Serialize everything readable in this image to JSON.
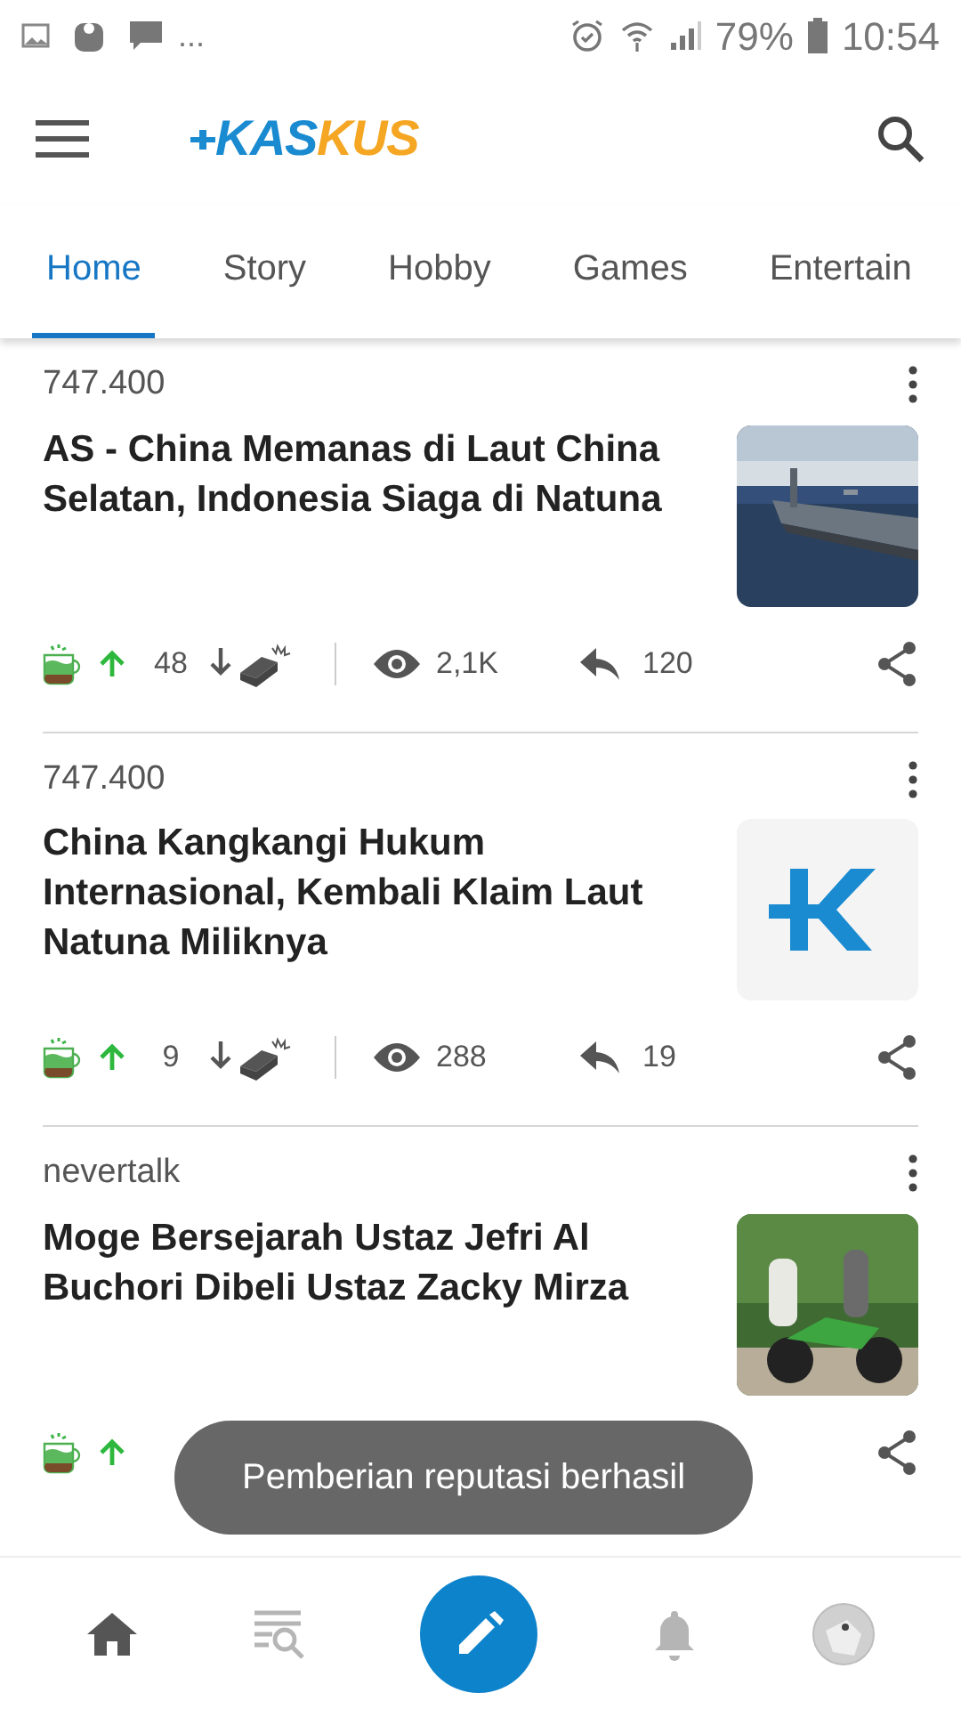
{
  "status_bar": {
    "more": "...",
    "battery": "79%",
    "time": "10:54"
  },
  "header": {
    "logo": {
      "first": "KAS",
      "second": "KUS"
    }
  },
  "tabs": [
    {
      "label": "Home",
      "selected": true
    },
    {
      "label": "Story",
      "selected": false
    },
    {
      "label": "Hobby",
      "selected": false
    },
    {
      "label": "Games",
      "selected": false
    },
    {
      "label": "Entertain",
      "selected": false
    }
  ],
  "posts": [
    {
      "category": "747.400",
      "title": "AS - China Memanas di Laut China Selatan, Indonesia Siaga di Natuna",
      "cendol": "48",
      "views": "2,1K",
      "replies": "120"
    },
    {
      "category": "747.400",
      "title": "China Kangkangi Hukum Internasional, Kembali Klaim Laut Natuna Miliknya",
      "thumbnail": {
        "kind": "logo"
      },
      "cendol": "9",
      "views": "288",
      "replies": "19"
    },
    {
      "category": "nevertalk",
      "title": "Moge Bersejarah Ustaz Jefri Al Buchori Dibeli Ustaz Zacky Mirza"
    }
  ],
  "toast": "Pemberian reputasi berhasil",
  "bottom_nav": [
    {
      "kind": "home",
      "selected": true
    },
    {
      "kind": "search",
      "selected": false
    },
    {
      "kind": "compose",
      "selected": false
    },
    {
      "kind": "bell",
      "selected": false
    },
    {
      "kind": "avatar",
      "selected": false
    }
  ]
}
